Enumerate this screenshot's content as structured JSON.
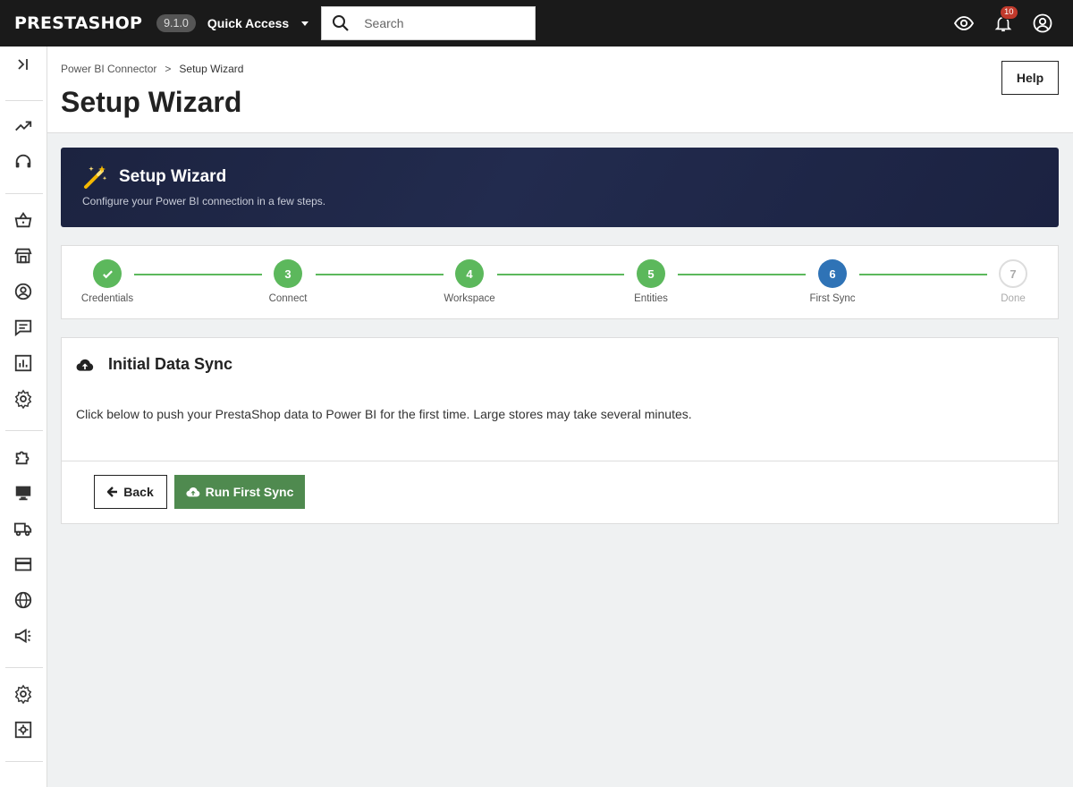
{
  "header": {
    "logo": "PRESTASHOP",
    "version": "9.1.0",
    "quick_access": "Quick Access",
    "search_placeholder": "Search",
    "notifications_count": "10"
  },
  "page": {
    "breadcrumb": [
      "Power BI Connector",
      ">",
      "Setup Wizard"
    ],
    "title": "Setup Wizard",
    "help_label": "Help"
  },
  "banner": {
    "title": "Setup Wizard",
    "subtitle": "Configure your Power BI connection in a few steps."
  },
  "steps": [
    {
      "marker": "",
      "label": "Credentials",
      "state": "done"
    },
    {
      "marker": "3",
      "label": "Connect",
      "state": "done"
    },
    {
      "marker": "4",
      "label": "Workspace",
      "state": "done"
    },
    {
      "marker": "5",
      "label": "Entities",
      "state": "done"
    },
    {
      "marker": "6",
      "label": "First Sync",
      "state": "active"
    },
    {
      "marker": "7",
      "label": "Done",
      "state": "todo"
    }
  ],
  "card": {
    "title": "Initial Data Sync",
    "text": "Click below to push your PrestaShop data to Power BI for the first time. Large stores may take several minutes.",
    "back_label": "Back",
    "sync_label": "Run First Sync"
  },
  "colors": {
    "success": "#5cb85c",
    "active": "#2f73b6",
    "sync_button": "#4f8a4f",
    "banner": "#1c2340"
  }
}
